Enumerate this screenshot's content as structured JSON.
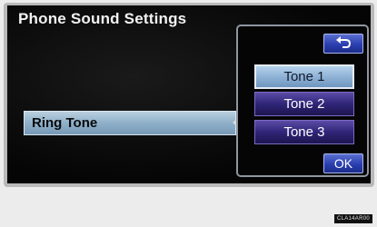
{
  "screen": {
    "title": "Phone Sound Settings"
  },
  "ring_tone": {
    "label": "Ring Tone"
  },
  "popup": {
    "back_icon": "return-arrow-icon",
    "options": [
      {
        "label": "Tone 1",
        "selected": true
      },
      {
        "label": "Tone 2",
        "selected": false
      },
      {
        "label": "Tone 3",
        "selected": false
      }
    ],
    "ok_label": "OK"
  },
  "image_code": "CLA14AR00",
  "colors": {
    "screen_background": "#050505",
    "selected_tone": "#8fb2d6",
    "tone_button": "#2f2578",
    "action_button": "#2b3fb0",
    "ring_tone_row": "#8fb0c9"
  }
}
